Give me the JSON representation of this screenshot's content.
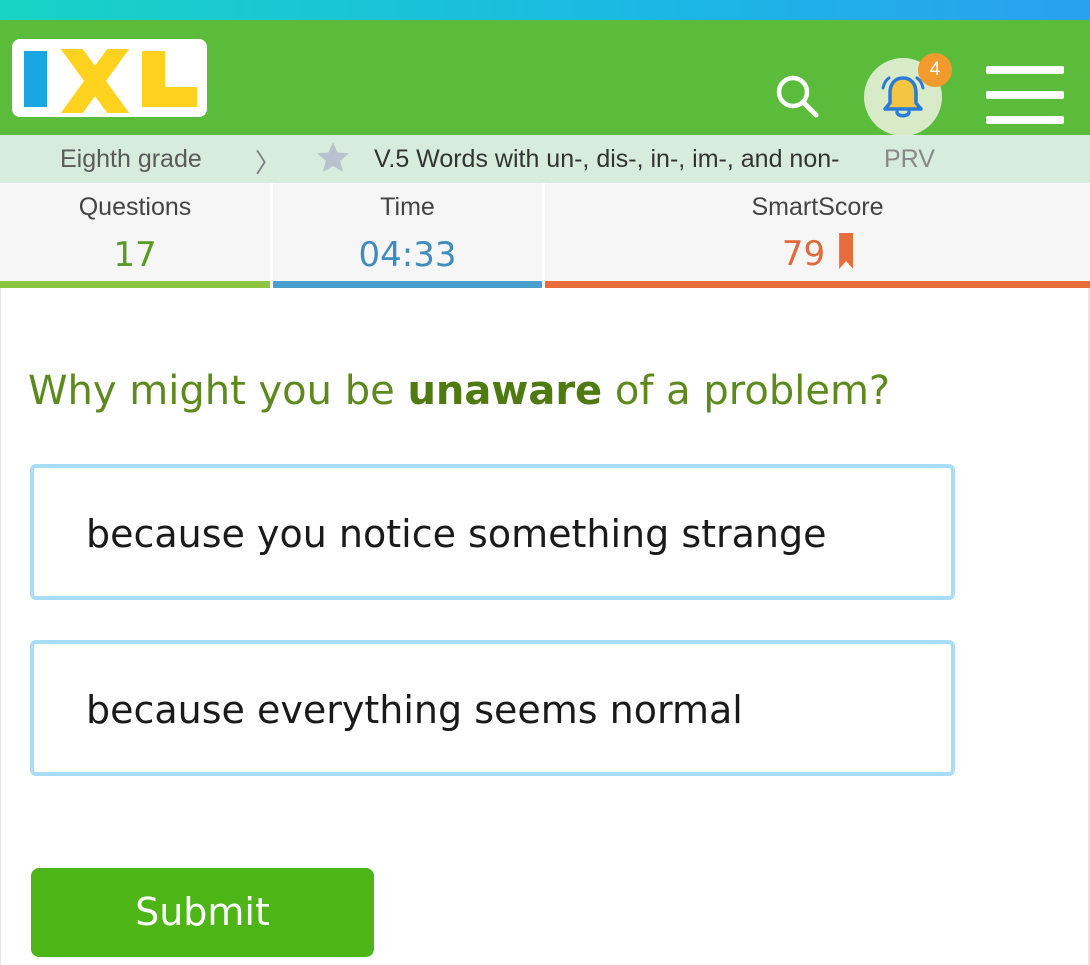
{
  "app": {
    "logo_text": "IXL",
    "notification_count": "4",
    "icons": {
      "search": "search-icon",
      "notifications": "bell-icon",
      "menu": "hamburger-menu-icon",
      "breadcrumb_separator": "chevron-right-icon",
      "favorite": "star-icon",
      "score_marker": "bookmark-ribbon-icon"
    }
  },
  "breadcrumb": {
    "grade": "Eighth grade",
    "skill": "V.5 Words with un-, dis-, in-, im-, and non-",
    "code": "PRV"
  },
  "stats": {
    "questions_label": "Questions",
    "questions_value": "17",
    "time_label": "Time",
    "time_value": "04:33",
    "smartscore_label": "SmartScore",
    "smartscore_value": "79"
  },
  "question": {
    "prefix": "Why might you be ",
    "keyword": "unaware",
    "suffix": " of a problem?"
  },
  "options": [
    {
      "label": "because you notice something strange"
    },
    {
      "label": "because everything seems normal"
    }
  ],
  "actions": {
    "submit_label": "Submit"
  },
  "colors": {
    "header_green": "#5bbb3a",
    "questions_accent": "#8cc63f",
    "time_accent": "#4a9fcc",
    "smartscore_accent": "#e86d3c",
    "option_border": "#a8ddf5",
    "submit_green": "#4db616"
  }
}
